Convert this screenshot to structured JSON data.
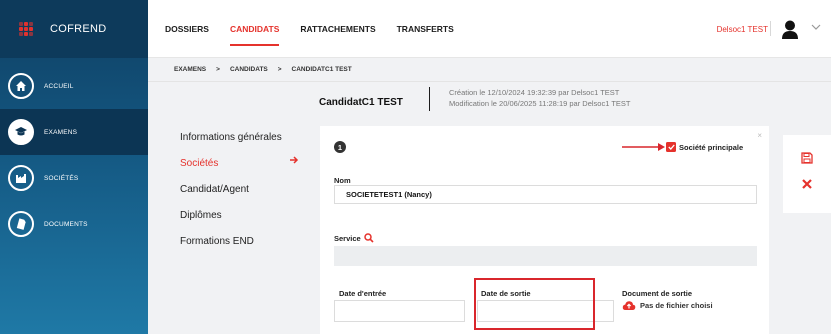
{
  "app": {
    "brand": "COFREND"
  },
  "sidebar": {
    "items": [
      {
        "label": "ACCUEIL",
        "icon": "home-icon"
      },
      {
        "label": "EXAMENS",
        "icon": "graduation-cap-icon",
        "active": true
      },
      {
        "label": "SOCIÉTÉS",
        "icon": "factory-icon"
      },
      {
        "label": "DOCUMENTS",
        "icon": "file-icon"
      }
    ]
  },
  "topnav": {
    "tabs": [
      {
        "label": "DOSSIERS"
      },
      {
        "label": "CANDIDATS",
        "active": true
      },
      {
        "label": "RATTACHEMENTS"
      },
      {
        "label": "TRANSFERTS"
      }
    ],
    "user": "Delsoc1 TEST"
  },
  "breadcrumb": {
    "items": [
      "EXAMENS",
      "CANDIDATS",
      "CANDIDATC1 TEST"
    ],
    "separator": ">"
  },
  "candidate": {
    "name": "CandidatC1 TEST",
    "created": "Création le 12/10/2024 19:32:39 par Delsoc1 TEST",
    "modified": "Modification le 20/06/2025 11:28:19 par Delsoc1 TEST"
  },
  "subnav": {
    "items": [
      {
        "label": "Informations générales"
      },
      {
        "label": "Sociétés",
        "active": true
      },
      {
        "label": "Candidat/Agent"
      },
      {
        "label": "Diplômes"
      },
      {
        "label": "Formations END"
      }
    ]
  },
  "form": {
    "index": "1",
    "close": "×",
    "main_company_label": "Société principale",
    "main_company_checked": true,
    "nom_label": "Nom",
    "nom_value": "SOCIETETEST1 (Nancy)",
    "service_label": "Service",
    "service_value": "",
    "date_entree_label": "Date d'entrée",
    "date_entree_value": "",
    "date_sortie_label": "Date de sortie",
    "date_sortie_value": "",
    "document_label": "Document de sortie",
    "document_value": "Pas de fichier choisi"
  },
  "colors": {
    "accent": "#e5322c",
    "sidebar": "#13557f",
    "highlight": "#d9262c"
  }
}
